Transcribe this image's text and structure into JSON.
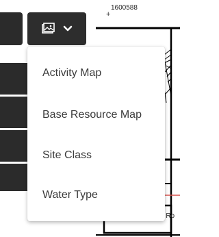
{
  "map": {
    "coordinate": "1600588",
    "crosshair": "+",
    "road_label_fragment": "e Ro"
  },
  "layer_button": {
    "icon": "map-icon",
    "caret": "chevron-down-icon"
  },
  "dropdown": {
    "items": [
      {
        "label": "Activity Map"
      },
      {
        "label": "Base Resource Map"
      },
      {
        "label": "Site Class"
      },
      {
        "label": "Water Type"
      }
    ]
  },
  "colors": {
    "toolbar_dark": "#2b2b2b",
    "menu_text": "#3a3a3a",
    "road_red": "#d9534f"
  }
}
